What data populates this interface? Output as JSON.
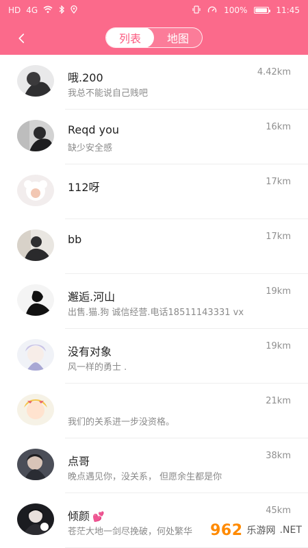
{
  "status_bar": {
    "left": [
      "HD",
      "4G",
      "wifi",
      "bluetooth",
      "location"
    ],
    "right": {
      "vibrate": "vibrate",
      "speed": "speed",
      "battery_text": "100%",
      "time": "11:45"
    }
  },
  "nav": {
    "back_icon": "chevron-left-icon",
    "tabs": [
      {
        "label": "列表",
        "active": true
      },
      {
        "label": "地图",
        "active": false
      }
    ]
  },
  "list": {
    "items": [
      {
        "name": "哦.200",
        "subtitle": "我总不能说自己贱吧",
        "distance": "4.42km"
      },
      {
        "name": "Reqd you",
        "subtitle": "缺少安全感",
        "distance": "16km"
      },
      {
        "name": "112呀",
        "subtitle": "",
        "distance": "17km"
      },
      {
        "name": "bb",
        "subtitle": "",
        "distance": "17km"
      },
      {
        "name": "邂逅.河山",
        "subtitle": "出售.猫.狗 诚信经营.电话18511143331 vx",
        "distance": "19km"
      },
      {
        "name": "没有对象",
        "subtitle": "风一样的勇士 .",
        "distance": "19km"
      },
      {
        "name": "",
        "subtitle": "我们的关系进一步没资格。",
        "distance": "21km"
      },
      {
        "name": "点哥",
        "subtitle": "晚点遇见你，没关系， 但愿余生都是你",
        "distance": "38km"
      },
      {
        "name": "倾颜",
        "subtitle": "苍茫大地一剑尽挽破，何处繁华",
        "distance": "45km"
      }
    ]
  },
  "watermark": {
    "logo": "962",
    "text": "乐游网",
    "suffix": ".NET"
  },
  "colors": {
    "primary": "#fb6a8b",
    "active_text": "#fb5a7f",
    "heart": "#ff4f79"
  }
}
